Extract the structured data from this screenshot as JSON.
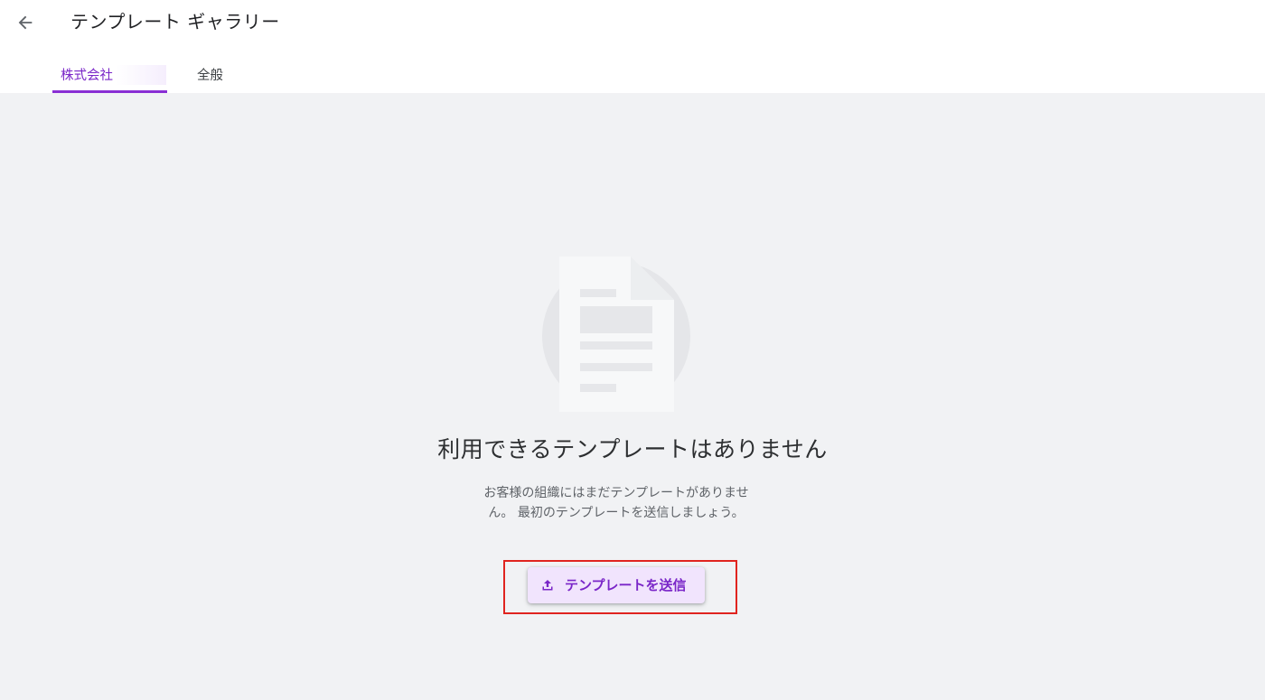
{
  "header": {
    "title": "テンプレート ギャラリー",
    "back_icon": "arrow-back-icon"
  },
  "tabs": [
    {
      "label": "株式会社",
      "selected": true
    },
    {
      "label": "全般",
      "selected": false
    }
  ],
  "empty_state": {
    "illustration_icon": "document-icon",
    "title": "利用できるテンプレートはありません",
    "description": "お客様の組織にはまだテンプレートがありません。 最初のテンプレートを送信しましょう。",
    "button": {
      "icon": "upload-icon",
      "label": "テンプレートを送信"
    }
  },
  "colors": {
    "accent": "#8a2fd4",
    "background": "#f1f2f4",
    "button_bg": "#f1e4fd",
    "highlight": "#e0241f"
  }
}
